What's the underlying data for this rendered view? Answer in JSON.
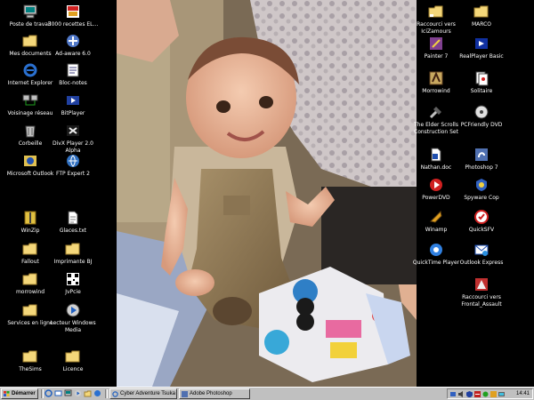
{
  "desktop": {
    "left_icons": [
      {
        "label": "Poste de travail",
        "icon": "computer-icon"
      },
      {
        "label": "3000 recettes EL...",
        "icon": "recipes-icon"
      },
      {
        "label": "Mes documents",
        "icon": "folder-icon"
      },
      {
        "label": "Ad-aware 6.0",
        "icon": "adaware-icon"
      },
      {
        "label": "Internet Explorer",
        "icon": "ie-icon"
      },
      {
        "label": "Bloc-notes",
        "icon": "notepad-icon"
      },
      {
        "label": "Voisinage réseau",
        "icon": "network-icon"
      },
      {
        "label": "BitPlayer",
        "icon": "bitplayer-icon"
      },
      {
        "label": "Corbeille",
        "icon": "recycle-bin-icon"
      },
      {
        "label": "DivX Player 2.0 Alpha",
        "icon": "divx-icon"
      },
      {
        "label": "Microsoft Outlook",
        "icon": "outlook-icon"
      },
      {
        "label": "FTP Expert 2",
        "icon": "ftp-icon"
      },
      {
        "label": "WinZip",
        "icon": "winzip-icon"
      },
      {
        "label": "Glaces.txt",
        "icon": "text-file-icon"
      },
      {
        "label": "Fallout",
        "icon": "folder-icon"
      },
      {
        "label": "Imprimante BJ",
        "icon": "folder-icon"
      },
      {
        "label": "morrowind",
        "icon": "folder-icon"
      },
      {
        "label": "JvPcie",
        "icon": "qr-icon"
      },
      {
        "label": "Services en ligne",
        "icon": "folder-icon"
      },
      {
        "label": "Lecteur Windows Media",
        "icon": "media-player-icon"
      },
      {
        "label": "TheSims",
        "icon": "folder-icon"
      },
      {
        "label": "Licence",
        "icon": "folder-icon"
      }
    ],
    "right_icons": [
      {
        "label": "Raccourci vers IciZamours",
        "icon": "folder-icon"
      },
      {
        "label": "MARCO",
        "icon": "folder-icon"
      },
      {
        "label": "Painter 7",
        "icon": "painter-icon"
      },
      {
        "label": "RealPlayer Basic",
        "icon": "realplayer-icon"
      },
      {
        "label": "Morrowind",
        "icon": "morrowind-icon"
      },
      {
        "label": "Solitaire",
        "icon": "solitaire-icon"
      },
      {
        "label": "The Elder Scrolls Construction Set",
        "icon": "construction-set-icon"
      },
      {
        "label": "PCFriendly DVD",
        "icon": "dvd-icon"
      },
      {
        "label": "Nathan.doc",
        "icon": "word-doc-icon"
      },
      {
        "label": "Photoshop 7",
        "icon": "photoshop-icon"
      },
      {
        "label": "PowerDVD",
        "icon": "powerdvd-icon"
      },
      {
        "label": "Spyware Cop",
        "icon": "spywarecop-icon"
      },
      {
        "label": "Winamp",
        "icon": "winamp-icon"
      },
      {
        "label": "QuickSFV",
        "icon": "quicksfv-icon"
      },
      {
        "label": "QuickTime Player",
        "icon": "quicktime-icon"
      },
      {
        "label": "Outlook Express",
        "icon": "outlook-express-icon"
      },
      {
        "label": "Raccourci vers Frontal_Assault",
        "icon": "frontal-assault-icon"
      }
    ]
  },
  "taskbar": {
    "start_label": "Démarrer",
    "tasks": [
      {
        "label": "Cyber Adventure Tsuka :...",
        "icon": "ie-icon"
      },
      {
        "label": "Adobe Photoshop",
        "icon": "photoshop-icon"
      }
    ],
    "clock": "14:41"
  },
  "colors": {
    "desktop_bg": "#000000",
    "taskbar_bg": "#c0c0c0",
    "icon_label": "#ffffff"
  }
}
